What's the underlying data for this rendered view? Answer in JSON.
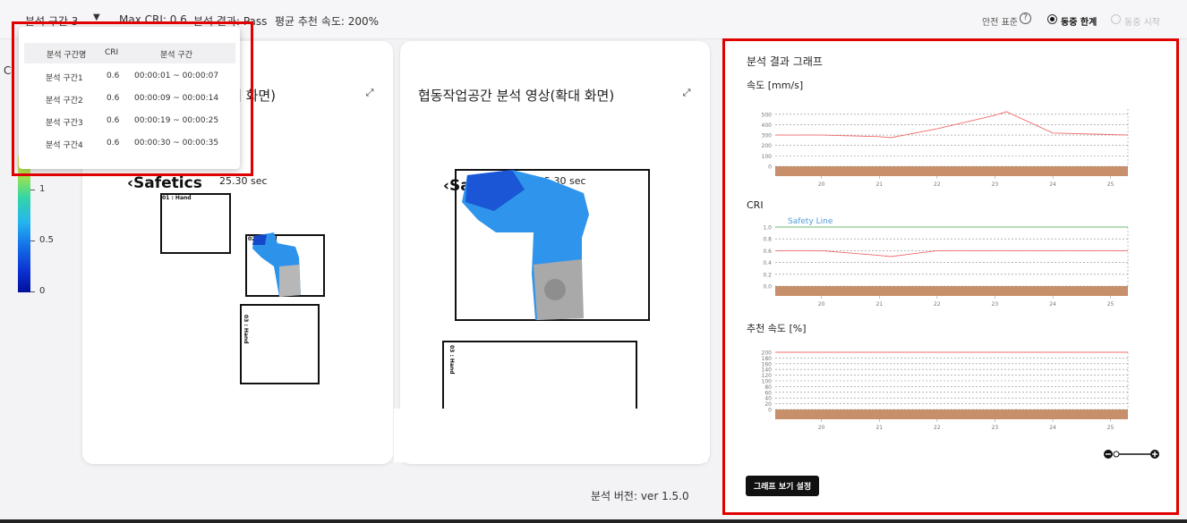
{
  "topbar": {
    "segment_select": "분석 구간 3",
    "max_cri": "Max CRI: 0.6",
    "result": "분석 결과: Pass",
    "avg_speed": "평균 추천 속도: 200%",
    "safety_standard_label": "안전 표준",
    "help_icon": "?",
    "radio_option_1": "동중 한계",
    "radio_option_2": "동중 시작",
    "selected_option": "동중 한계"
  },
  "popup": {
    "headers": [
      "분석 구간명",
      "CRI",
      "분석 구간"
    ],
    "rows": [
      {
        "name": "분석 구간1",
        "cri": "0.6",
        "range": "00:00:01 ~ 00:00:07"
      },
      {
        "name": "분석 구간2",
        "cri": "0.6",
        "range": "00:00:09 ~ 00:00:14"
      },
      {
        "name": "분석 구간3",
        "cri": "0.6",
        "range": "00:00:19 ~ 00:00:25"
      },
      {
        "name": "분석 구간4",
        "cri": "0.6",
        "range": "00:00:30 ~ 00:00:35"
      }
    ]
  },
  "colorbar": {
    "labels": [
      "1",
      "0.5",
      "0"
    ],
    "cropped_label": "C"
  },
  "card1": {
    "title": "체 화면)",
    "logo": "Safetics",
    "time": "25.30 sec",
    "label1": "01 : Hand",
    "label2": "02 : Hand",
    "label3": "03 : Hand"
  },
  "card2": {
    "title": "협동작업공간 분석 영상(확대 화면)",
    "logo": "Safetics",
    "time": "25.30 sec",
    "label3": "03 : Hand"
  },
  "version": "분석 버전: ver 1.5.0",
  "right_panel": {
    "title": "분석 결과 그래프",
    "graph_settings_button": "그래프 보기 설정"
  },
  "chart_data": [
    {
      "type": "line",
      "title": "속도 [mm/s]",
      "x": [
        19.2,
        20,
        21,
        21.2,
        22,
        23,
        23.2,
        24,
        25,
        25.3
      ],
      "series": [
        {
          "values": [
            300,
            300,
            285,
            275,
            360,
            490,
            525,
            320,
            305,
            300
          ]
        }
      ],
      "xticks": [
        "20",
        "21",
        "22",
        "23",
        "24",
        "25"
      ],
      "yticks": [
        "0",
        "100",
        "200",
        "300",
        "400",
        "500"
      ],
      "ylim": [
        0,
        550
      ],
      "grid": true,
      "line_color": "#ef6b6b"
    },
    {
      "type": "line",
      "title": "CRI",
      "annotation": "Safety Line",
      "safety_line_value": 1.0,
      "x": [
        19.2,
        20,
        21,
        21.2,
        22,
        23,
        24,
        25,
        25.3
      ],
      "series": [
        {
          "values": [
            0.6,
            0.6,
            0.52,
            0.5,
            0.6,
            0.6,
            0.6,
            0.6,
            0.6
          ]
        }
      ],
      "xticks": [
        "20",
        "21",
        "22",
        "23",
        "24",
        "25"
      ],
      "yticks": [
        "0.0",
        "0.2",
        "0.4",
        "0.6",
        "0.8",
        "1.0"
      ],
      "ylim": [
        0,
        1.0
      ],
      "grid": true,
      "line_color": "#ef6b6b",
      "safety_color": "#4f9ad8"
    },
    {
      "type": "line",
      "title": "추천 속도 [%]",
      "x": [
        19.2,
        25.3
      ],
      "series": [
        {
          "values": [
            200,
            200
          ]
        }
      ],
      "xticks": [
        "20",
        "21",
        "22",
        "23",
        "24",
        "25"
      ],
      "yticks": [
        "0",
        "20",
        "40",
        "60",
        "80",
        "100",
        "120",
        "140",
        "160",
        "180",
        "200"
      ],
      "ylim": [
        0,
        200
      ],
      "grid": true,
      "line_color": "#ef6b6b"
    }
  ]
}
